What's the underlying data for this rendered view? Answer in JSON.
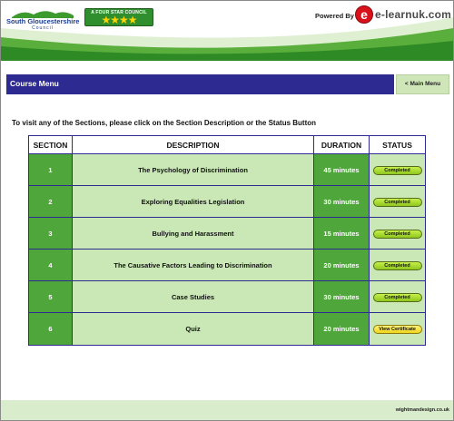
{
  "header": {
    "council_name": "South Gloucestershire",
    "council_sub": "Council",
    "star_badge_text": "A FOUR STAR COUNCIL",
    "star_badge_stars": "★★★★",
    "powered_by": "Powered By",
    "elogo_letter": "e",
    "elogo_text": "e-learnuk.com"
  },
  "menubar": {
    "title": "Course Menu",
    "main_menu_label": "< Main Menu"
  },
  "instructions": "To visit any of the Sections, please click on the Section Description or the Status Button",
  "table": {
    "headers": [
      "SECTION",
      "DESCRIPTION",
      "DURATION",
      "STATUS"
    ],
    "rows": [
      {
        "section": "1",
        "description": "The Psychology of Discrimination",
        "duration": "45 minutes",
        "status": "Completed"
      },
      {
        "section": "2",
        "description": "Exploring Equalities Legislation",
        "duration": "30 minutes",
        "status": "Completed"
      },
      {
        "section": "3",
        "description": "Bullying and Harassment",
        "duration": "15 minutes",
        "status": "Completed"
      },
      {
        "section": "4",
        "description": "The Causative Factors Leading to Discrimination",
        "duration": "20 minutes",
        "status": "Completed"
      },
      {
        "section": "5",
        "description": "Case Studies",
        "duration": "30 minutes",
        "status": "Completed"
      },
      {
        "section": "6",
        "description": "Quiz",
        "duration": "20 minutes",
        "status": "View Certificate"
      }
    ]
  },
  "footer": {
    "credit": "wightmandesign.co.uk"
  },
  "colors": {
    "menubar": "#2d2a92",
    "section_green": "#4fa63a",
    "light_green": "#c9e8b6",
    "completed": "#a8dc2a",
    "certificate": "#f6e23a",
    "brand_red": "#d9111a"
  }
}
